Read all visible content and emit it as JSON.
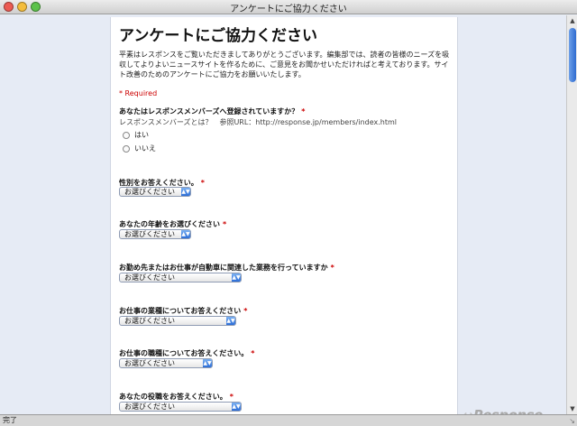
{
  "window": {
    "title": "アンケートにご協力ください",
    "controls": {
      "close_color": "#ec5b53",
      "minimize_color": "#f4bd3c",
      "zoom_color": "#5cc24a"
    }
  },
  "form": {
    "title": "アンケートにご協力ください",
    "intro": "平素はレスポンスをご覧いただきましてありがとうございます。編集部では、読者の皆様のニーズを吸収してよりよいニュースサイトを作るために、ご意見をお聞かせいただければと考えております。サイト改善のためのアンケートにご協力をお願いいたします。",
    "required_note": "* Required",
    "questions": [
      {
        "label": "あなたはレスポンスメンバーズへ登録されていますか？",
        "required_mark": "*",
        "help": "レスポンスメンバーズとは？　参照URL：http://response.jp/members/index.html",
        "options": [
          "はい",
          "いいえ"
        ]
      },
      {
        "label": "性別をお答えください。",
        "required_mark": "*",
        "select_value": "お選びください"
      },
      {
        "label": "あなたの年齢をお選びください",
        "required_mark": "*",
        "select_value": "お選びください"
      },
      {
        "label": "お勤め先またはお仕事が自動車に関連した業務を行っていますか",
        "required_mark": "*",
        "select_value": "お選びください"
      },
      {
        "label": "お仕事の業種についてお答えください",
        "required_mark": "*",
        "select_value": "お選びください"
      },
      {
        "label": "お仕事の職種についてお答えください。",
        "required_mark": "*",
        "select_value": "お選びください"
      },
      {
        "label": "あなたの役職をお答えください。",
        "required_mark": "*",
        "select_value": "お選びください"
      }
    ]
  },
  "status": {
    "text": "完了"
  },
  "watermark": {
    "text": "Response."
  },
  "colors": {
    "required": "#cc0000",
    "select_accent": "#2b6cd6",
    "page_bg": "#e6ebf5"
  }
}
